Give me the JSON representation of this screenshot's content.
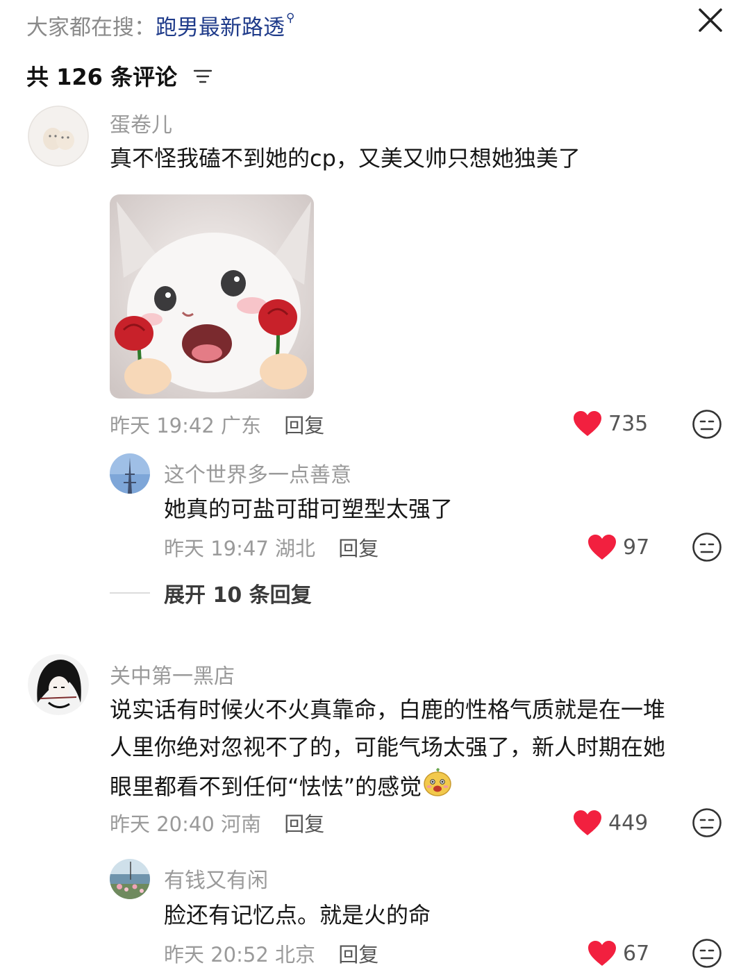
{
  "search": {
    "prefix": "大家都在搜：",
    "term": "跑男最新路透"
  },
  "header": {
    "count_label": "共 126 条评论"
  },
  "comments": [
    {
      "user": "蛋卷儿",
      "text": "真不怪我磕不到她的cp，又美又帅只想她独美了",
      "time": "昨天 19:42",
      "location": "广东",
      "reply_label": "回复",
      "likes": "735",
      "replies": [
        {
          "user": "这个世界多一点善意",
          "text": "她真的可盐可甜可塑型太强了",
          "time": "昨天 19:47",
          "location": "湖北",
          "reply_label": "回复",
          "likes": "97"
        }
      ],
      "expand_label": "展开 10 条回复"
    },
    {
      "user": "关中第一黑店",
      "text_lines": [
        "说实话有时候火不火真靠命，白鹿的性格气质就是在一堆",
        "人里你绝对忽视不了的，可能气场太强了，新人时期在她",
        "眼里都看不到任何“怯怯”的感觉"
      ],
      "time": "昨天 20:40",
      "location": "河南",
      "reply_label": "回复",
      "likes": "449",
      "replies": [
        {
          "user": "有钱又有闲",
          "text": "脸还有记忆点。就是火的命",
          "time": "昨天 20:52",
          "location": "北京",
          "reply_label": "回复",
          "likes": "67"
        }
      ]
    }
  ],
  "colors": {
    "like": "#f2203f",
    "search_term": "#1f3b8a",
    "muted": "#9a9a9a"
  },
  "icons": {
    "close": "close-icon",
    "sort": "sort-icon",
    "like": "heart-icon",
    "dislike": "neutral-face-icon",
    "search": "search-icon"
  }
}
